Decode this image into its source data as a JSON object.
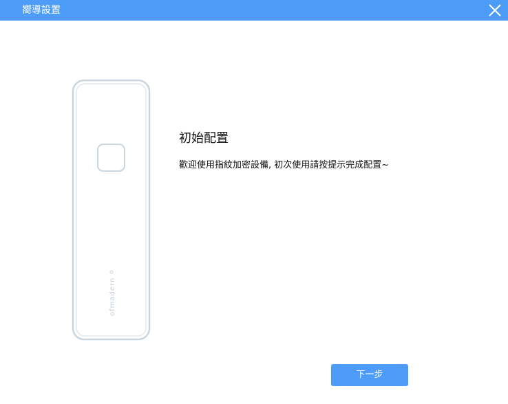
{
  "window": {
    "title": "嚮導設置",
    "close_icon": "close-icon"
  },
  "illustration": {
    "icon": "fingerprint-device-icon",
    "brand_text": "ofmadern"
  },
  "content": {
    "heading": "初始配置",
    "description": "歡迎使用指紋加密設備, 初次使用請按提示完成配置~"
  },
  "footer": {
    "next_label": "下一步"
  },
  "colors": {
    "accent": "#4d9cf8",
    "device_outline": "#cbd6e0"
  }
}
